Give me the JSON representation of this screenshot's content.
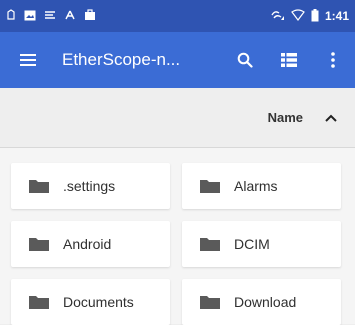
{
  "status_bar": {
    "time": "1:41",
    "left_icons": [
      "notification-icon",
      "image-icon",
      "signal-app-icon",
      "vpn-icon",
      "briefcase-icon"
    ],
    "right_icons": [
      "signal-strength-icon",
      "wifi-icon",
      "battery-icon"
    ]
  },
  "app_bar": {
    "title": "EtherScope-n...",
    "icons": [
      "menu-icon",
      "search-icon",
      "list-view-icon",
      "more-vert-icon"
    ]
  },
  "sort": {
    "label": "Name",
    "direction": "ascending"
  },
  "files": [
    {
      "name": ".settings"
    },
    {
      "name": "Alarms"
    },
    {
      "name": "Android"
    },
    {
      "name": "DCIM"
    },
    {
      "name": "Documents"
    },
    {
      "name": "Download"
    }
  ],
  "colors": {
    "status_bar": "#2f54b2",
    "app_bar": "#3b6cd5",
    "folder": "#5a5a5a"
  }
}
